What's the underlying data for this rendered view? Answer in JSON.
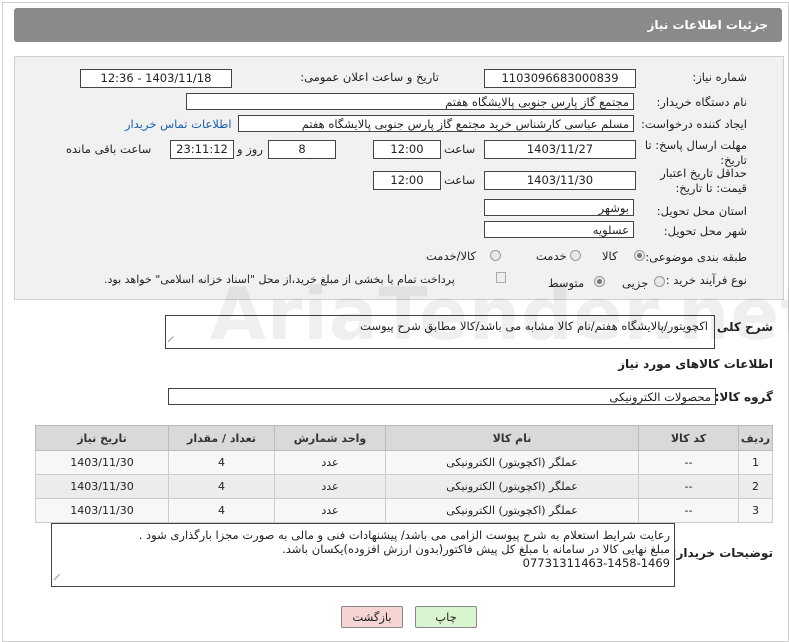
{
  "header": {
    "title": "جزئیات اطلاعات نیاز"
  },
  "form": {
    "need_number_label": "شماره نیاز:",
    "need_number": "1103096683000839",
    "announce_label": "تاریخ و ساعت اعلان عمومی:",
    "announce_value": "1403/11/18 - 12:36",
    "buyer_org_label": "نام دستگاه خریدار:",
    "buyer_org": "مجتمع گاز پارس جنوبی  پالایشگاه هفتم",
    "creator_label": "ایجاد کننده درخواست:",
    "creator": "مسلم عباسی کارشناس خرید مجتمع گاز پارس جنوبی  پالایشگاه هفتم",
    "contact_link": "اطلاعات تماس خریدار",
    "deadline_label": "مهلت ارسال پاسخ: تا تاریخ:",
    "deadline_date": "1403/11/27",
    "time_label": "ساعت",
    "deadline_time": "12:00",
    "days_value": "8",
    "days_label": "روز و",
    "remaining_time": "23:11:12",
    "remaining_label": "ساعت باقی مانده",
    "price_validity_label": "حداقل تاریخ اعتبار قیمت: تا تاریخ:",
    "price_validity_date": "1403/11/30",
    "price_validity_time": "12:00",
    "province_label": "استان محل تحویل:",
    "province": "بوشهر",
    "city_label": "شهر محل تحویل:",
    "city": "عسلویه",
    "category_label": "طبقه بندی موضوعی:",
    "category_options": [
      "کالا",
      "خدمت",
      "کالا/خدمت"
    ],
    "process_label": "نوع فرآیند خرید :",
    "process_options": [
      "جزیی",
      "متوسط"
    ],
    "payment_note": "پرداخت تمام یا بخشی از مبلغ خرید،از محل \"اسناد خزانه اسلامی\" خواهد بود.",
    "general_desc_label": "شرح کلی نیاز:",
    "general_desc": "اکچویتور/پالایشگاه هفتم/نام کالا مشابه می باشد/کالا مطابق شرح پیوست"
  },
  "goods": {
    "section_title": "اطلاعات کالاهای مورد نیاز",
    "group_label": "گروه کالا:",
    "group_value": "محصولات الکترونیکی",
    "columns": [
      "ردیف",
      "کد کالا",
      "نام کالا",
      "واحد شمارش",
      "تعداد / مقدار",
      "تاریخ نیاز"
    ],
    "rows": [
      [
        "1",
        "--",
        "عملگر (اکچویتور) الکترونیکی",
        "عدد",
        "4",
        "1403/11/30"
      ],
      [
        "2",
        "--",
        "عملگر (اکچویتور) الکترونیکی",
        "عدد",
        "4",
        "1403/11/30"
      ],
      [
        "3",
        "--",
        "عملگر (اکچویتور) الکترونیکی",
        "عدد",
        "4",
        "1403/11/30"
      ]
    ]
  },
  "buyer_notes": {
    "label": "توضیحات خریدار:",
    "line1": "رعایت شرایط استعلام به شرح پیوست الزامی می باشد/ پیشنهادات فنی و مالی به صورت مجزا بارگذاری شود .",
    "line2": "مبلغ نهایی کالا در سامانه با مبلغ کل پیش فاکتور(بدون ارزش افزوده)یکسان باشد.",
    "line3": "07731311463-1458-1469"
  },
  "buttons": {
    "print": "چاپ",
    "back": "بازگشت"
  },
  "watermark": "AriaTender.net",
  "colors": {
    "header_bg": "#8a8a8a",
    "link": "#1a5fb4",
    "print_btn": "#d8f5d0",
    "back_btn": "#f7d4d4"
  }
}
